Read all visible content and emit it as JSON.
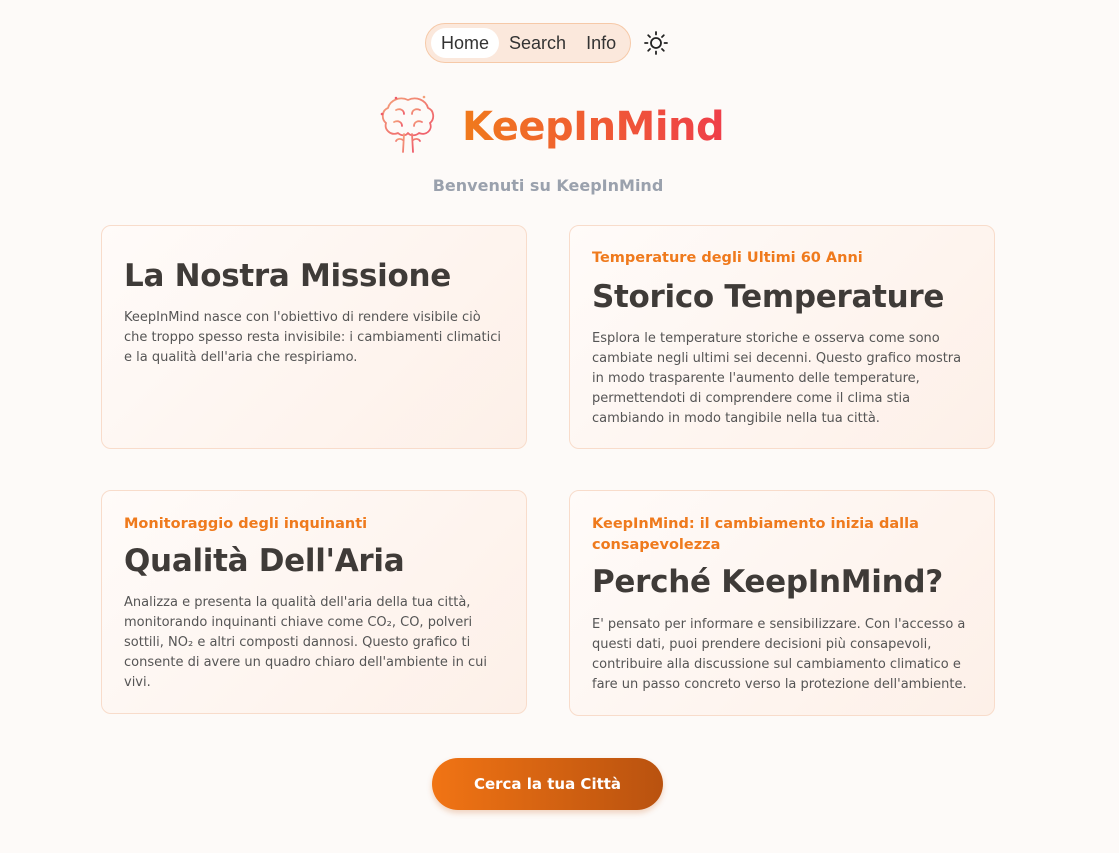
{
  "nav": {
    "items": [
      {
        "label": "Home",
        "active": true
      },
      {
        "label": "Search",
        "active": false
      },
      {
        "label": "Info",
        "active": false
      }
    ],
    "theme_toggle_icon": "sun-icon"
  },
  "logo": {
    "icon": "brain-tree-icon",
    "text": "KeepInMind",
    "colors": [
      "#f07a1c",
      "#ef3e4a"
    ]
  },
  "subtitle": "Benvenuti su KeepInMind",
  "cards": [
    {
      "kicker": "",
      "title": "La Nostra Missione",
      "body": "KeepInMind nasce con l'obiettivo di rendere visibile ciò che troppo spesso resta invisibile: i cambiamenti climatici e la qualità dell'aria che respiriamo."
    },
    {
      "kicker": "Temperature degli Ultimi 60 Anni",
      "title": "Storico Temperature",
      "body": "Esplora le temperature storiche e osserva come sono cambiate negli ultimi sei decenni. Questo grafico mostra in modo trasparente l'aumento delle temperature, permettendoti di comprendere come il clima stia cambiando in modo tangibile nella tua città."
    },
    {
      "kicker": "Monitoraggio degli inquinanti",
      "title": "Qualità Dell'Aria",
      "body": "Analizza e presenta la qualità dell'aria della tua città, monitorando inquinanti chiave come CO₂, CO, polveri sottili, NO₂ e altri composti dannosi. Questo grafico ti consente di avere un quadro chiaro dell'ambiente in cui vivi."
    },
    {
      "kicker": "KeepInMind: il cambiamento inizia dalla consapevolezza",
      "title": "Perché KeepInMind?",
      "body": "E' pensato per informare e sensibilizzare. Con l'accesso a questi dati, puoi prendere decisioni più consapevoli, contribuire alla discussione sul cambiamento climatico e fare un passo concreto verso la protezione dell'ambiente."
    }
  ],
  "cta": {
    "label": "Cerca la tua Città",
    "colors": [
      "#f17414",
      "#b9520f"
    ]
  },
  "accent_color": "#ef7a1d"
}
